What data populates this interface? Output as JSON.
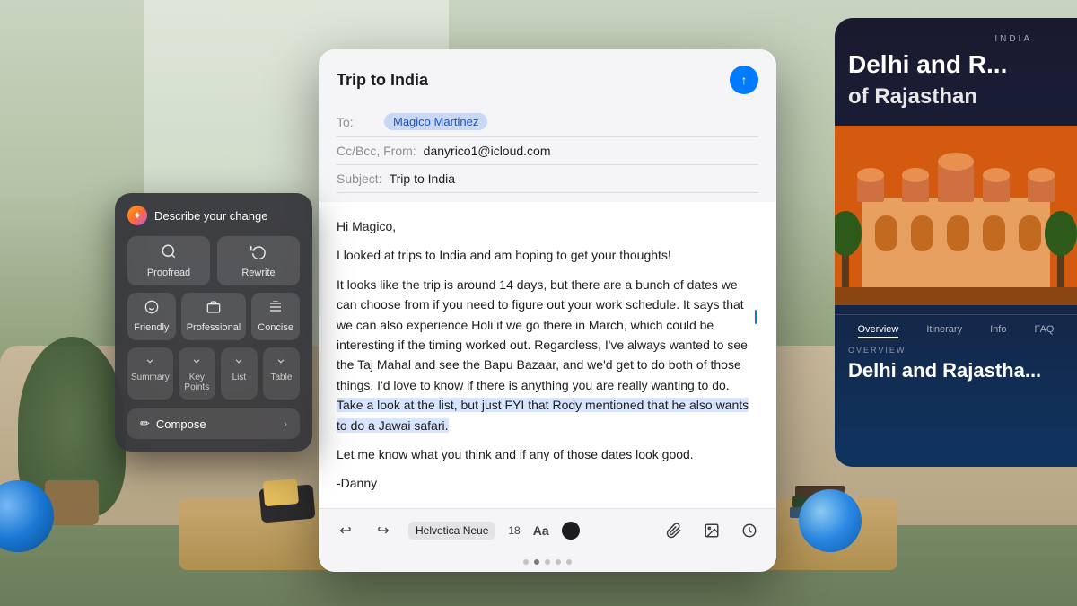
{
  "background": {
    "description": "Living room with couch, plants, and coffee table"
  },
  "email": {
    "title": "Trip to India",
    "send_button_label": "↑",
    "fields": {
      "to_label": "To:",
      "recipient": "Magico Martinez",
      "ccbcc_label": "Cc/Bcc, From:",
      "from_address": "danyrico1@icloud.com",
      "subject_label": "Subject:",
      "subject": "Trip to India"
    },
    "body": {
      "greeting": "Hi Magico,",
      "intro": "I looked at trips to India and am hoping to get your thoughts!",
      "paragraph1": "It looks like the trip is around 14 days, but there are a bunch of dates we can choose from if you need to figure out your work schedule. It says that we can also experience Holi if we go there in March, which could be interesting if the timing worked out. Regardless, I've always wanted to see the Taj Mahal and see the Bapu Bazaar, and we'd get to do both of those things.  I'd love to know if there is anything you are really wanting to do. Take a look at the list, but just FYI that Rody mentioned that he also wants to do a Jawai safari.",
      "paragraph2": "Let me know what you think and if any of those dates look good.",
      "signature": "-Danny"
    },
    "toolbar": {
      "undo": "↩",
      "redo": "↪",
      "font": "Helvetica Neue",
      "size": "18",
      "aa": "Aa",
      "attachment_icon": "📎",
      "image_icon": "🖼",
      "timer_icon": "⏱"
    }
  },
  "ai_panel": {
    "icon": "✦",
    "title": "Describe your change",
    "buttons": {
      "proofread": {
        "label": "Proofread",
        "icon": "🔍"
      },
      "rewrite": {
        "label": "Rewrite",
        "icon": "↻"
      },
      "friendly": {
        "label": "Friendly",
        "icon": "😊"
      },
      "professional": {
        "label": "Professional",
        "icon": "💼"
      },
      "concise": {
        "label": "Concise",
        "icon": "≡"
      },
      "summary": {
        "label": "Summary",
        "icon": "⬇"
      },
      "key_points": {
        "label": "Key Points",
        "icon": "⬇"
      },
      "list": {
        "label": "List",
        "icon": "⬇"
      },
      "table": {
        "label": "Table",
        "icon": "⬇"
      }
    },
    "compose_label": "Compose",
    "compose_icon": "✏"
  },
  "right_panel": {
    "country_label": "INDIA",
    "title": "Delhi and R...",
    "subtitle": "of...",
    "nav_items": [
      {
        "label": "Overview",
        "active": true
      },
      {
        "label": "Itinerary",
        "active": false
      },
      {
        "label": "Info",
        "active": false
      },
      {
        "label": "FAQ",
        "active": false
      }
    ],
    "overview_label": "OVERVIEW",
    "overview_title": "Delhi and Rajastha..."
  }
}
